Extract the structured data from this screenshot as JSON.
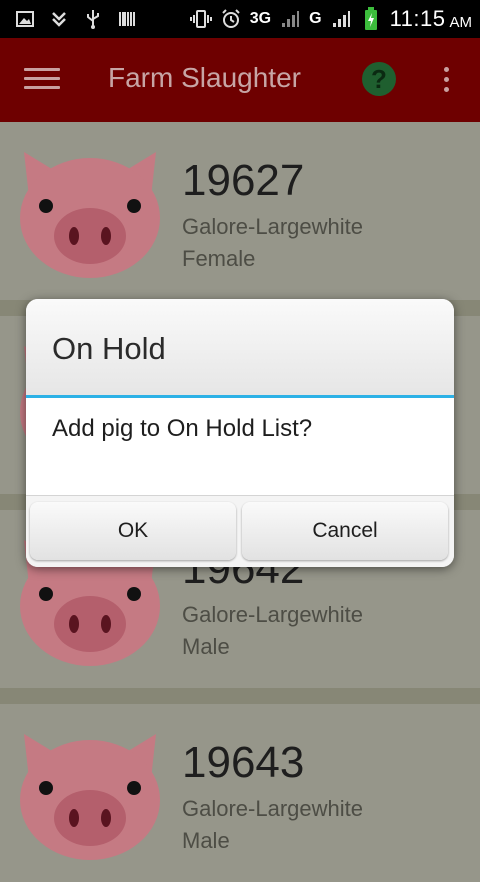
{
  "status_bar": {
    "network_label": "3G",
    "network_label_2": "G",
    "time": "11:15",
    "ampm": "AM"
  },
  "app_bar": {
    "title": "Farm Slaughter",
    "help_label": "?"
  },
  "pigs": [
    {
      "id": "19627",
      "breed": "Galore-Largewhite",
      "sex": "Female"
    },
    {
      "id": "",
      "breed": "",
      "sex": ""
    },
    {
      "id": "19642",
      "breed": "Galore-Largewhite",
      "sex": "Male"
    },
    {
      "id": "19643",
      "breed": "Galore-Largewhite",
      "sex": "Male"
    }
  ],
  "dialog": {
    "title": "On Hold",
    "message": "Add pig to On Hold List?",
    "ok_label": "OK",
    "cancel_label": "Cancel"
  },
  "colors": {
    "app_bar": "#6e0000",
    "accent": "#2cb1e6",
    "pig_pink": "#c57a83"
  }
}
